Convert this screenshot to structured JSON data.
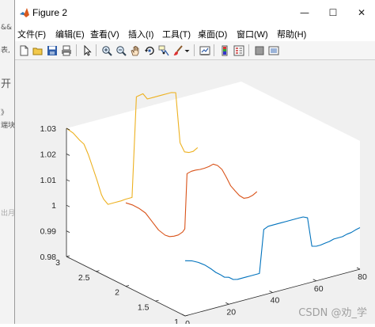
{
  "background": {
    "lines": [
      "&&",
      "表,",
      "开",
      "》",
      "端块",
      "出月"
    ]
  },
  "window": {
    "title": "Figure 2",
    "controls": {
      "minimize": "—",
      "maximize": "☐",
      "close": "✕"
    }
  },
  "menu": [
    "文件(F)",
    "编辑(E)",
    "查看(V)",
    "插入(I)",
    "工具(T)",
    "桌面(D)",
    "窗口(W)",
    "帮助(H)"
  ],
  "toolbar": {
    "icons": [
      "new-figure-icon",
      "open-file-icon",
      "save-icon",
      "print-icon",
      "select-arrow-icon",
      "zoom-in-icon",
      "zoom-out-icon",
      "pan-hand-icon",
      "rotate-3d-icon",
      "data-cursor-icon",
      "brush-icon",
      "brush-dropdown-icon",
      "link-plot-icon",
      "insert-colorbar-icon",
      "insert-legend-icon",
      "hide-plot-tools-icon",
      "show-plot-tools-icon"
    ]
  },
  "watermark": "CSDN @劝_学",
  "colors": {
    "series1": "#0072BD",
    "series2": "#D95319",
    "series3": "#EDB120"
  },
  "chart_data": {
    "type": "line",
    "projection": "3d",
    "title": "",
    "xlabel": "",
    "ylabel": "",
    "zlabel": "",
    "xlim": [
      0,
      80
    ],
    "ylim": [
      1,
      3
    ],
    "zlim": [
      0.98,
      1.03
    ],
    "xticks": [
      "0",
      "20",
      "40",
      "60",
      "80"
    ],
    "yticks": [
      "1",
      "1.5",
      "2",
      "2.5",
      "3"
    ],
    "zticks": [
      "0.98",
      "0.99",
      "1",
      "1.01",
      "1.02",
      "1.03"
    ],
    "grid": false,
    "series": [
      {
        "y": 1,
        "color": "#0072BD",
        "x": [
          0,
          3,
          6,
          9,
          12,
          14,
          16,
          18,
          20,
          22,
          24,
          26,
          28,
          30,
          32,
          34,
          36,
          38,
          40,
          42,
          44,
          46,
          48,
          50,
          52,
          54,
          56,
          58,
          60,
          62,
          64,
          66,
          68,
          70,
          72,
          74,
          76,
          78,
          80
        ],
        "z": [
          1.0015,
          1.0008,
          0.9995,
          0.9978,
          0.9955,
          0.9938,
          0.9925,
          0.991,
          0.9905,
          0.9892,
          0.9888,
          0.9888,
          0.9888,
          0.9888,
          0.9888,
          0.9888,
          1.0055,
          1.0063,
          1.0063,
          1.0063,
          1.0063,
          1.0063,
          1.0063,
          1.0063,
          1.0063,
          1.0063,
          1.0055,
          0.994,
          0.9935,
          0.9935,
          0.9938,
          0.994,
          0.9945,
          0.9945,
          0.9945,
          0.995,
          0.9952,
          0.9958,
          0.9962
        ]
      },
      {
        "y": 2,
        "color": "#D95319",
        "x": [
          0,
          3,
          6,
          9,
          12,
          15,
          18,
          20,
          22,
          24,
          26,
          27,
          28,
          30,
          32,
          34,
          36,
          38,
          40,
          42,
          44,
          46,
          48,
          50,
          52,
          54,
          56,
          58,
          60
        ],
        "z": [
          1.0125,
          1.011,
          1.009,
          1.0065,
          1.0025,
          0.9985,
          0.9958,
          0.9948,
          0.9945,
          0.9945,
          0.9952,
          0.9962,
          1.0175,
          1.018,
          1.018,
          1.0178,
          1.0178,
          1.018,
          1.0185,
          1.0175,
          1.0155,
          1.012,
          1.0082,
          1.0058,
          1.0035,
          1.002,
          1.0018,
          1.0022,
          1.0032
        ]
      },
      {
        "y": 3,
        "color": "#EDB120",
        "x": [
          0,
          3,
          6,
          8,
          10,
          12,
          14,
          16,
          17,
          19,
          22,
          25,
          27,
          30,
          32,
          35,
          37,
          40,
          42,
          44,
          46,
          48,
          50,
          52,
          54,
          56,
          58,
          60
        ],
        "z": [
          1.03,
          1.0275,
          1.024,
          1.022,
          1.0175,
          1.012,
          1.0065,
          1.0005,
          0.9985,
          0.996,
          0.996,
          0.996,
          0.9962,
          0.9962,
          1.035,
          1.0355,
          1.033,
          1.033,
          1.033,
          1.033,
          1.033,
          1.033,
          1.0325,
          1.0125,
          1.0085,
          1.0078,
          1.0078,
          1.0088
        ]
      }
    ]
  }
}
